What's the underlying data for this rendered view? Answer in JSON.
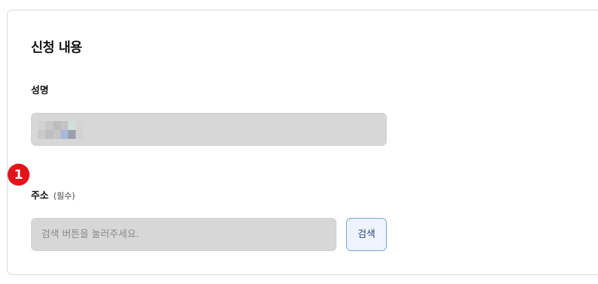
{
  "form": {
    "title": "신청 내용",
    "name_label": "성명",
    "name_value_redacted": true,
    "step_badge": "1",
    "address_label": "주소",
    "address_required": "(필수)",
    "address_placeholder": "검색 버튼을 눌러주세요.",
    "address_value": "",
    "search_button_label": "검색"
  },
  "colors": {
    "badge": "#e3121b",
    "field_bg": "#d7d7d7",
    "button_border": "#6d9ae0",
    "button_bg": "#eef4ff",
    "mosaic": [
      "#d2d2d2",
      "#c8c8c8",
      "#bdbdbd",
      "#c4c4c4",
      "#cfe0db",
      "#d4d4d4",
      "#c9c9c9",
      "#bebebe",
      "#c6c6c6",
      "#a9b7d8",
      "#9aa0aa",
      "#d2d2d2"
    ]
  }
}
